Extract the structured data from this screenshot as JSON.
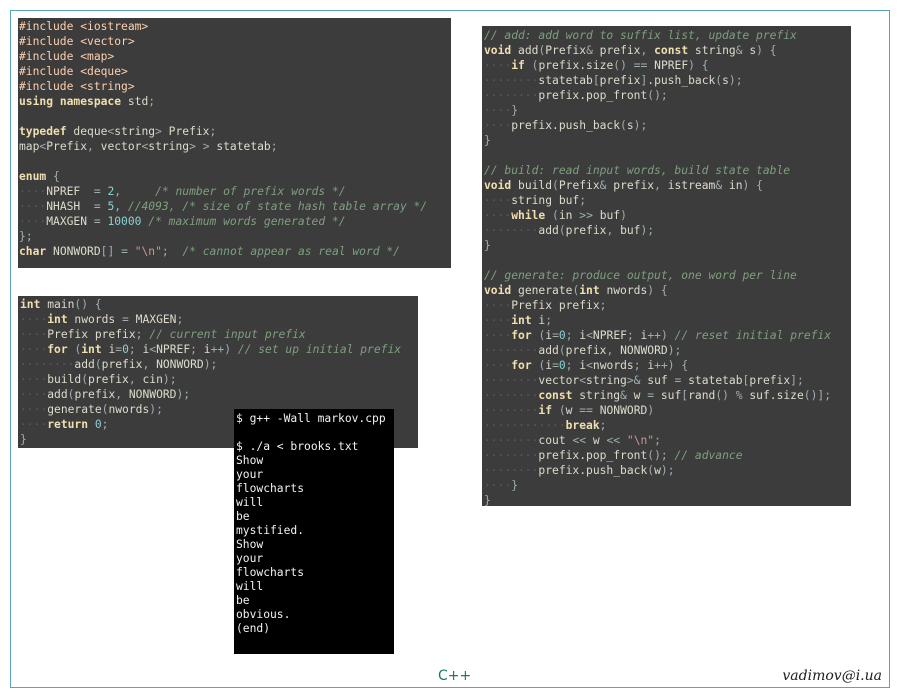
{
  "code_blocks": {
    "includes": [
      "#include <iostream>",
      "#include <vector>",
      "#include <map>",
      "#include <deque>",
      "#include <string>",
      "using namespace std;",
      "",
      "typedef deque<string> Prefix;",
      "map<Prefix, vector<string> > statetab;",
      "",
      "enum {",
      "    NPREF  = 2,     /* number of prefix words */",
      "    NHASH  = 5, //4093, /* size of state hash table array */",
      "    MAXGEN = 10000 /* maximum words generated */",
      "};",
      "char NONWORD[] = \"\\n\";  /* cannot appear as real word */"
    ],
    "main": [
      "int main() {",
      "    int nwords = MAXGEN;",
      "    Prefix prefix; // current input prefix",
      "    for (int i=0; i<NPREF; i++) // set up initial prefix",
      "        add(prefix, NONWORD);",
      "    build(prefix, cin);",
      "    add(prefix, NONWORD);",
      "    generate(nwords);",
      "    return 0;",
      "}"
    ],
    "functions": [
      "// add: add word to suffix list, update prefix",
      "void add(Prefix& prefix, const string& s) {",
      "    if (prefix.size() == NPREF) {",
      "        statetab[prefix].push_back(s);",
      "        prefix.pop_front();",
      "    }",
      "    prefix.push_back(s);",
      "}",
      "",
      "// build: read input words, build state table",
      "void build(Prefix& prefix, istream& in) {",
      "    string buf;",
      "    while (in >> buf)",
      "        add(prefix, buf);",
      "}",
      "",
      "// generate: produce output, one word per line",
      "void generate(int nwords) {",
      "    Prefix prefix;",
      "    int i;",
      "    for (i=0; i<NPREF; i++) // reset initial prefix",
      "        add(prefix, NONWORD);",
      "    for (i=0; i<nwords; i++) {",
      "        vector<string>& suf = statetab[prefix];",
      "        const string& w = suf[rand() % suf.size()];",
      "        if (w == NONWORD)",
      "            break;",
      "        cout << w << \"\\n\";",
      "        prefix.pop_front(); // advance",
      "        prefix.push_back(w);",
      "    }",
      "}"
    ]
  },
  "terminal": {
    "lines": [
      "$ g++ -Wall markov.cpp",
      "",
      "$ ./a < brooks.txt",
      "Show",
      "your",
      "flowcharts",
      "will",
      "be",
      "mystified.",
      "Show",
      "your",
      "flowcharts",
      "will",
      "be",
      "obvious.",
      "(end)"
    ]
  },
  "footer": {
    "language": "C++",
    "author": "vadimov@i.ua"
  },
  "colors": {
    "panel_bg": "#3c3c3c",
    "terminal_bg": "#000000",
    "keyword": "#f0dfaf",
    "preprocessor": "#ffcfaf",
    "comment": "#7f9f7f",
    "number": "#8cd0d3",
    "string": "#cc9393",
    "frame_border": "#5aa6b4"
  }
}
